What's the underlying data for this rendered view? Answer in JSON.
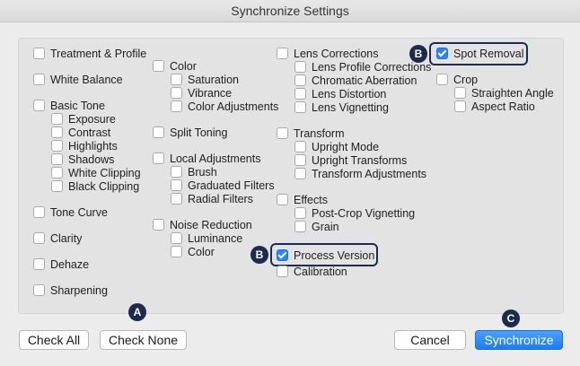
{
  "window": {
    "title": "Synchronize Settings"
  },
  "col1": {
    "treatment_profile": "Treatment & Profile",
    "white_balance": "White Balance",
    "basic_tone": "Basic Tone",
    "exposure": "Exposure",
    "contrast": "Contrast",
    "highlights": "Highlights",
    "shadows": "Shadows",
    "white_clipping": "White Clipping",
    "black_clipping": "Black Clipping",
    "tone_curve": "Tone Curve",
    "clarity": "Clarity",
    "dehaze": "Dehaze",
    "sharpening": "Sharpening"
  },
  "col2": {
    "color": "Color",
    "saturation": "Saturation",
    "vibrance": "Vibrance",
    "color_adjustments": "Color Adjustments",
    "split_toning": "Split Toning",
    "local_adjustments": "Local Adjustments",
    "brush": "Brush",
    "graduated_filters": "Graduated Filters",
    "radial_filters": "Radial Filters",
    "noise_reduction": "Noise Reduction",
    "luminance": "Luminance",
    "nr_color": "Color"
  },
  "col3": {
    "lens_corrections": "Lens Corrections",
    "lens_profile_corrections": "Lens Profile Corrections",
    "chromatic_aberration": "Chromatic Aberration",
    "lens_distortion": "Lens Distortion",
    "lens_vignetting": "Lens Vignetting",
    "transform": "Transform",
    "upright_mode": "Upright Mode",
    "upright_transforms": "Upright Transforms",
    "transform_adjustments": "Transform Adjustments",
    "effects": "Effects",
    "post_crop_vignetting": "Post-Crop Vignetting",
    "grain": "Grain",
    "process_version": "Process Version",
    "calibration": "Calibration"
  },
  "col4": {
    "spot_removal": "Spot Removal",
    "crop": "Crop",
    "straighten_angle": "Straighten Angle",
    "aspect_ratio": "Aspect Ratio"
  },
  "badges": {
    "a": "A",
    "b": "B",
    "c": "C"
  },
  "buttons": {
    "check_all": "Check All",
    "check_none": "Check None",
    "cancel": "Cancel",
    "synchronize": "Synchronize"
  },
  "colors": {
    "accent": "#2f84f5",
    "badge": "#1f2a4f"
  }
}
